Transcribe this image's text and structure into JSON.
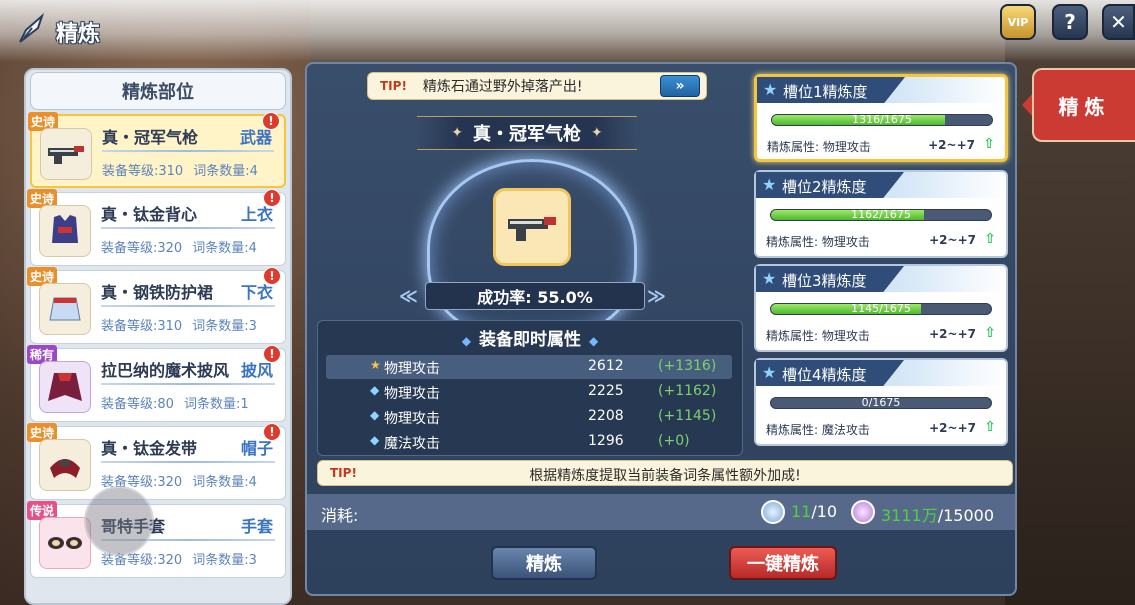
{
  "header": {
    "title": "精炼",
    "vip_label": "VIP",
    "help_label": "?",
    "close_label": "✕"
  },
  "left": {
    "title": "精炼部位",
    "items": [
      {
        "rarity": "史诗",
        "name": "真・冠军气枪",
        "slot": "武器",
        "level": "装备等级:310",
        "entries": "词条数量:4",
        "icon": "gun-icon",
        "alert": "!"
      },
      {
        "rarity": "史诗",
        "name": "真・钛金背心",
        "slot": "上衣",
        "level": "装备等级:320",
        "entries": "词条数量:4",
        "icon": "vest-icon",
        "alert": "!"
      },
      {
        "rarity": "史诗",
        "name": "真・钢铁防护裙",
        "slot": "下衣",
        "level": "装备等级:310",
        "entries": "词条数量:3",
        "icon": "skirt-icon",
        "alert": "!"
      },
      {
        "rarity": "稀有",
        "name": "拉巴纳的魔术披风",
        "slot": "披风",
        "level": "装备等级:80",
        "entries": "词条数量:1",
        "icon": "cape-icon",
        "alert": "!"
      },
      {
        "rarity": "史诗",
        "name": "真・钛金发带",
        "slot": "帽子",
        "level": "装备等级:320",
        "entries": "词条数量:4",
        "icon": "headband-icon",
        "alert": "!"
      },
      {
        "rarity": "传说",
        "name": "哥特手套",
        "slot": "手套",
        "level": "装备等级:320",
        "entries": "词条数量:3",
        "icon": "gloves-icon",
        "alert": "!"
      }
    ]
  },
  "center": {
    "tip_tag": "TIP!",
    "tip_top": "精炼石通过野外掉落产出!",
    "tip_arrow": "»",
    "item_name": "真・冠军气枪",
    "success_rate": "成功率: 55.0%",
    "attrs_title": "装备即时属性",
    "attrs": [
      {
        "name": "物理攻击",
        "value": "2612",
        "bonus": "(+1316)",
        "icon": "star-icon"
      },
      {
        "name": "物理攻击",
        "value": "2225",
        "bonus": "(+1162)",
        "icon": "diamond-icon"
      },
      {
        "name": "物理攻击",
        "value": "2208",
        "bonus": "(+1145)",
        "icon": "diamond-icon"
      },
      {
        "name": "魔法攻击",
        "value": "1296",
        "bonus": "(+0)",
        "icon": "diamond-icon"
      }
    ],
    "tip_bottom": "根据精炼度提取当前装备词条属性额外加成!",
    "cost_label": "消耗:",
    "cost_stone_have": "11",
    "cost_stone_need": "/10",
    "cost_gold_have": "3111万",
    "cost_gold_need": "/15000",
    "btn_refine": "精炼",
    "btn_onekey": "一键精炼"
  },
  "slots": [
    {
      "title": "槽位1精炼度",
      "progress": "1316/1675",
      "fraction": 0.7857,
      "attr": "精炼属性: 物理攻击",
      "range": "+2~+7"
    },
    {
      "title": "槽位2精炼度",
      "progress": "1162/1675",
      "fraction": 0.6937,
      "attr": "精炼属性: 物理攻击",
      "range": "+2~+7"
    },
    {
      "title": "槽位3精炼度",
      "progress": "1145/1675",
      "fraction": 0.6836,
      "attr": "精炼属性: 物理攻击",
      "range": "+2~+7"
    },
    {
      "title": "槽位4精炼度",
      "progress": "0/1675",
      "fraction": 0,
      "attr": "精炼属性: 魔法攻击",
      "range": "+2~+7"
    }
  ],
  "side_tab": "精炼",
  "colors": {
    "accent_green": "#4ed23b",
    "refine_red": "#cc3a34",
    "selected_gold": "#f4c640"
  }
}
